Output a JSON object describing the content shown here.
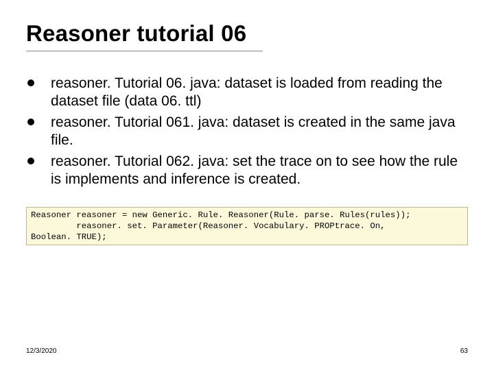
{
  "title": "Reasoner tutorial 06",
  "bullets": [
    "reasoner. Tutorial 06. java: dataset is loaded from reading the dataset file (data 06. ttl)",
    "reasoner. Tutorial 061. java: dataset is created in the same java file.",
    "reasoner. Tutorial 062. java: set the trace on to see how the rule is implements and inference is created."
  ],
  "code": "Reasoner reasoner = new Generic. Rule. Reasoner(Rule. parse. Rules(rules));\n         reasoner. set. Parameter(Reasoner. Vocabulary. PROPtrace. On,\nBoolean. TRUE);",
  "footer": {
    "date": "12/3/2020",
    "page": "63"
  }
}
